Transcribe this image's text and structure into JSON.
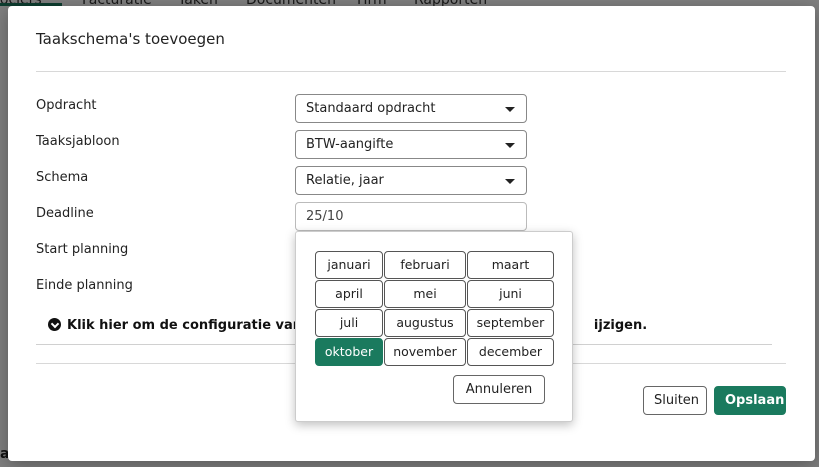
{
  "background": {
    "nav": [
      "lociers",
      "Facturatie",
      "Taken",
      "Documenten",
      "Hrm",
      "Rapporten"
    ],
    "footer_title": "akplanning"
  },
  "modal": {
    "title": "Taakschema's toevoegen",
    "fields": {
      "opdracht": {
        "label": "Opdracht",
        "value": "Standaard opdracht"
      },
      "taaksjabloon": {
        "label": "Taaksjabloon",
        "value": "BTW-aangifte"
      },
      "schema": {
        "label": "Schema",
        "value": "Relatie, jaar"
      },
      "deadline": {
        "label": "Deadline",
        "value": "25/10"
      },
      "start_planning": {
        "label": "Start planning"
      },
      "einde_planning": {
        "label": "Einde planning"
      }
    },
    "config_toggle": {
      "prefix": "Klik hier om de configuratie van d",
      "suffix": "ijzigen."
    },
    "buttons": {
      "close": "Sluiten",
      "save": "Opslaan"
    }
  },
  "month_picker": {
    "months": [
      "januari",
      "februari",
      "maart",
      "april",
      "mei",
      "juni",
      "juli",
      "augustus",
      "september",
      "oktober",
      "november",
      "december"
    ],
    "selected": "oktober",
    "cancel_label": "Annuleren"
  },
  "colors": {
    "accent": "#1a7a5e"
  }
}
